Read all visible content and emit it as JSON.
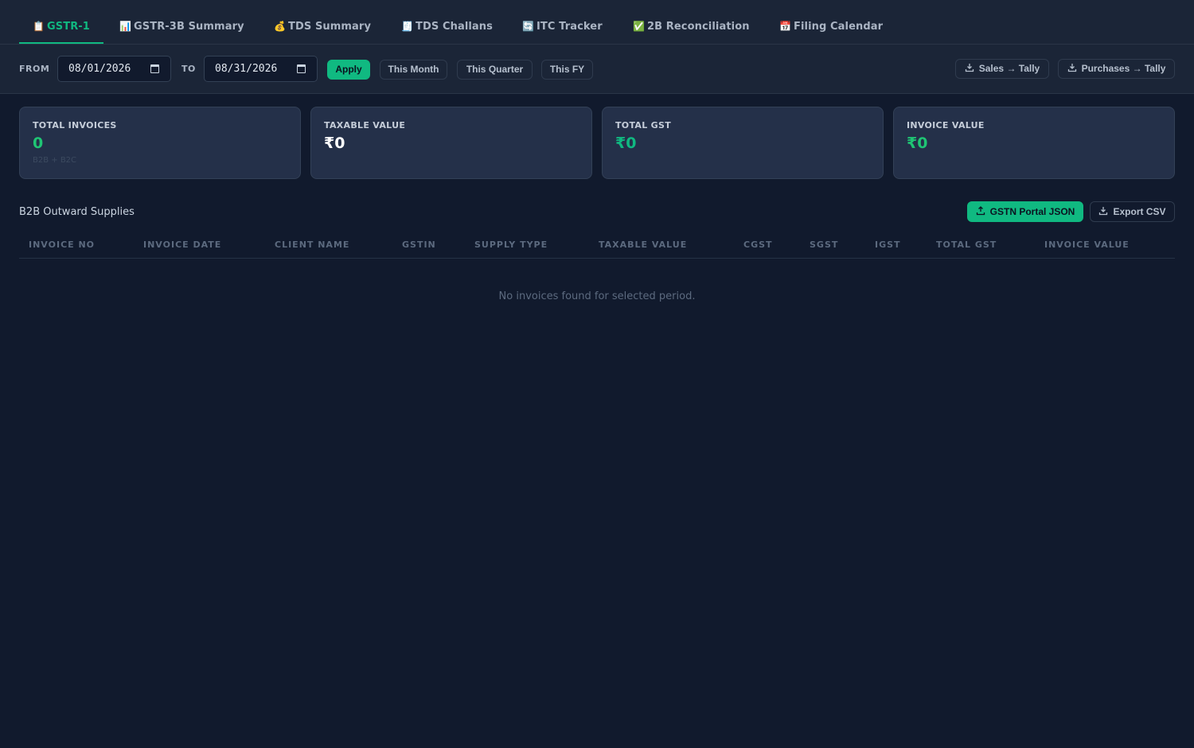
{
  "tabs": [
    {
      "icon": "📋",
      "label": "GSTR-1",
      "active": true
    },
    {
      "icon": "📊",
      "label": "GSTR-3B Summary"
    },
    {
      "icon": "💰",
      "label": "TDS Summary"
    },
    {
      "icon": "🧾",
      "label": "TDS Challans"
    },
    {
      "icon": "🔄",
      "label": "ITC Tracker"
    },
    {
      "icon": "✅",
      "label": "2B Reconciliation"
    },
    {
      "icon": "📅",
      "label": "Filing Calendar"
    }
  ],
  "filters": {
    "from_label": "FROM",
    "from_value": "08/01/2026",
    "to_label": "TO",
    "to_value": "08/31/2026",
    "apply": "Apply",
    "this_month": "This Month",
    "this_quarter": "This Quarter",
    "this_fy": "This FY",
    "sales_tally": "Sales → Tally",
    "purchases_tally": "Purchases → Tally"
  },
  "cards": [
    {
      "title": "TOTAL INVOICES",
      "value": "0",
      "sub": "B2B + B2C"
    },
    {
      "title": "TAXABLE VALUE",
      "value": "₹0"
    },
    {
      "title": "TOTAL GST",
      "value": "₹0"
    },
    {
      "title": "INVOICE VALUE",
      "value": "₹0"
    }
  ],
  "section": {
    "title": "B2B Outward Supplies",
    "gstn_json": "GSTN Portal JSON",
    "export_csv": "Export CSV"
  },
  "table": {
    "columns": [
      "INVOICE NO",
      "INVOICE DATE",
      "CLIENT NAME",
      "GSTIN",
      "SUPPLY TYPE",
      "TAXABLE VALUE",
      "CGST",
      "SGST",
      "IGST",
      "TOTAL GST",
      "INVOICE VALUE"
    ],
    "empty_message": "No invoices found for selected period."
  },
  "colors": {
    "accent": "#10b981",
    "background": "#111a2d",
    "panel": "#1b2537",
    "card": "#243049"
  }
}
